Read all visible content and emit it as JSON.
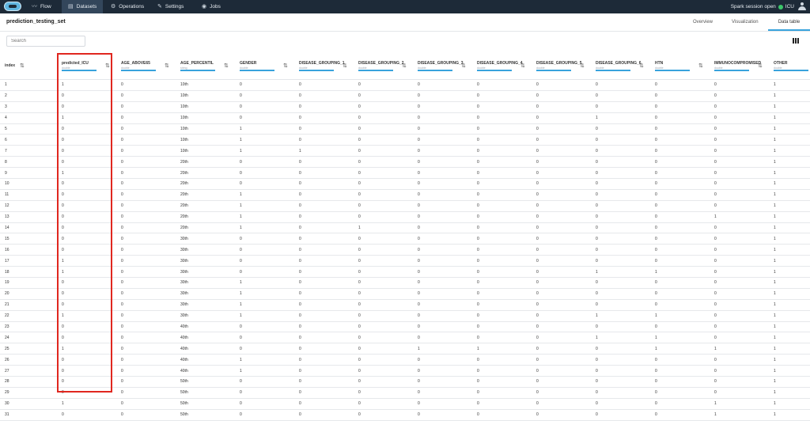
{
  "nav": {
    "items": [
      {
        "label": "Flow",
        "icon": "flow-icon",
        "glyph": "〰"
      },
      {
        "label": "Datasets",
        "icon": "datasets-icon",
        "glyph": "▤"
      },
      {
        "label": "Operations",
        "icon": "gear-icon",
        "glyph": "⚙"
      },
      {
        "label": "Settings",
        "icon": "wrench-icon",
        "glyph": "✎"
      },
      {
        "label": "Jobs",
        "icon": "jobs-icon",
        "glyph": "◉"
      }
    ],
    "active": "Datasets",
    "session_text": "Spark session open",
    "session_name": "ICU"
  },
  "dataset": {
    "title": "prediction_testing_set"
  },
  "tabs": [
    "Overview",
    "Visualization",
    "Data table"
  ],
  "active_tab": "Data table",
  "search": {
    "placeholder": "Search"
  },
  "colors": {
    "accent": "#39a3dc",
    "highlight": "#e0271f",
    "topbar": "#1d2a38",
    "session_ok": "#3cc66a"
  },
  "table": {
    "index_header": "index",
    "columns": [
      {
        "name": "predicted_ICU",
        "type": "double"
      },
      {
        "name": "AGE_ABOVE65",
        "type": "double"
      },
      {
        "name": "AGE_PERCENTIL",
        "type": "string"
      },
      {
        "name": "GENDER",
        "type": "double"
      },
      {
        "name": "DISEASE_GROUPING_1",
        "type": "double"
      },
      {
        "name": "DISEASE_GROUPING_2",
        "type": "double"
      },
      {
        "name": "DISEASE_GROUPING_3",
        "type": "double"
      },
      {
        "name": "DISEASE_GROUPING_4",
        "type": "double"
      },
      {
        "name": "DISEASE_GROUPING_5",
        "type": "double"
      },
      {
        "name": "DISEASE_GROUPING_6",
        "type": "double"
      },
      {
        "name": "HTN",
        "type": "double"
      },
      {
        "name": "IMMUNOCOMPROMISED",
        "type": "double"
      },
      {
        "name": "OTHER",
        "type": "double"
      }
    ],
    "rows": [
      [
        "1",
        "1",
        "0",
        "10th",
        "0",
        "0",
        "0",
        "0",
        "0",
        "0",
        "0",
        "0",
        "0",
        "1"
      ],
      [
        "2",
        "0",
        "0",
        "10th",
        "0",
        "0",
        "0",
        "0",
        "0",
        "0",
        "0",
        "0",
        "0",
        "1"
      ],
      [
        "3",
        "0",
        "0",
        "10th",
        "0",
        "0",
        "0",
        "0",
        "0",
        "0",
        "0",
        "0",
        "0",
        "1"
      ],
      [
        "4",
        "1",
        "0",
        "10th",
        "0",
        "0",
        "0",
        "0",
        "0",
        "0",
        "1",
        "0",
        "0",
        "1"
      ],
      [
        "5",
        "0",
        "0",
        "10th",
        "1",
        "0",
        "0",
        "0",
        "0",
        "0",
        "0",
        "0",
        "0",
        "1"
      ],
      [
        "6",
        "0",
        "0",
        "10th",
        "1",
        "0",
        "0",
        "0",
        "0",
        "0",
        "0",
        "0",
        "0",
        "1"
      ],
      [
        "7",
        "0",
        "0",
        "10th",
        "1",
        "1",
        "0",
        "0",
        "0",
        "0",
        "0",
        "0",
        "0",
        "1"
      ],
      [
        "8",
        "0",
        "0",
        "20th",
        "0",
        "0",
        "0",
        "0",
        "0",
        "0",
        "0",
        "0",
        "0",
        "1"
      ],
      [
        "9",
        "1",
        "0",
        "20th",
        "0",
        "0",
        "0",
        "0",
        "0",
        "0",
        "0",
        "0",
        "0",
        "1"
      ],
      [
        "10",
        "0",
        "0",
        "20th",
        "0",
        "0",
        "0",
        "0",
        "0",
        "0",
        "0",
        "0",
        "0",
        "1"
      ],
      [
        "11",
        "0",
        "0",
        "20th",
        "1",
        "0",
        "0",
        "0",
        "0",
        "0",
        "0",
        "0",
        "0",
        "1"
      ],
      [
        "12",
        "0",
        "0",
        "20th",
        "1",
        "0",
        "0",
        "0",
        "0",
        "0",
        "0",
        "0",
        "0",
        "1"
      ],
      [
        "13",
        "0",
        "0",
        "20th",
        "1",
        "0",
        "0",
        "0",
        "0",
        "0",
        "0",
        "0",
        "1",
        "1"
      ],
      [
        "14",
        "0",
        "0",
        "20th",
        "1",
        "0",
        "1",
        "0",
        "0",
        "0",
        "0",
        "0",
        "0",
        "1"
      ],
      [
        "15",
        "0",
        "0",
        "30th",
        "0",
        "0",
        "0",
        "0",
        "0",
        "0",
        "0",
        "0",
        "0",
        "1"
      ],
      [
        "16",
        "0",
        "0",
        "30th",
        "0",
        "0",
        "0",
        "0",
        "0",
        "0",
        "0",
        "0",
        "0",
        "1"
      ],
      [
        "17",
        "1",
        "0",
        "30th",
        "0",
        "0",
        "0",
        "0",
        "0",
        "0",
        "0",
        "0",
        "0",
        "1"
      ],
      [
        "18",
        "1",
        "0",
        "30th",
        "0",
        "0",
        "0",
        "0",
        "0",
        "0",
        "1",
        "1",
        "0",
        "1"
      ],
      [
        "19",
        "0",
        "0",
        "30th",
        "1",
        "0",
        "0",
        "0",
        "0",
        "0",
        "0",
        "0",
        "0",
        "1"
      ],
      [
        "20",
        "0",
        "0",
        "30th",
        "1",
        "0",
        "0",
        "0",
        "0",
        "0",
        "0",
        "0",
        "0",
        "1"
      ],
      [
        "21",
        "0",
        "0",
        "30th",
        "1",
        "0",
        "0",
        "0",
        "0",
        "0",
        "0",
        "0",
        "0",
        "1"
      ],
      [
        "22",
        "1",
        "0",
        "30th",
        "1",
        "0",
        "0",
        "0",
        "0",
        "0",
        "1",
        "1",
        "0",
        "1"
      ],
      [
        "23",
        "0",
        "0",
        "40th",
        "0",
        "0",
        "0",
        "0",
        "0",
        "0",
        "0",
        "0",
        "0",
        "1"
      ],
      [
        "24",
        "0",
        "0",
        "40th",
        "0",
        "0",
        "0",
        "0",
        "0",
        "0",
        "1",
        "1",
        "0",
        "1"
      ],
      [
        "25",
        "1",
        "0",
        "40th",
        "0",
        "0",
        "0",
        "1",
        "1",
        "0",
        "0",
        "1",
        "1",
        "1"
      ],
      [
        "26",
        "0",
        "0",
        "40th",
        "1",
        "0",
        "0",
        "0",
        "0",
        "0",
        "0",
        "0",
        "0",
        "1"
      ],
      [
        "27",
        "0",
        "0",
        "40th",
        "1",
        "0",
        "0",
        "0",
        "0",
        "0",
        "0",
        "0",
        "0",
        "1"
      ],
      [
        "28",
        "0",
        "0",
        "50th",
        "0",
        "0",
        "0",
        "0",
        "0",
        "0",
        "0",
        "0",
        "0",
        "1"
      ],
      [
        "29",
        "0",
        "0",
        "50th",
        "0",
        "0",
        "0",
        "0",
        "0",
        "0",
        "0",
        "0",
        "0",
        "1"
      ],
      [
        "30",
        "1",
        "0",
        "50th",
        "0",
        "0",
        "0",
        "0",
        "0",
        "0",
        "0",
        "0",
        "1",
        "1"
      ],
      [
        "31",
        "0",
        "0",
        "50th",
        "0",
        "0",
        "0",
        "0",
        "0",
        "0",
        "0",
        "0",
        "1",
        "1"
      ]
    ]
  }
}
